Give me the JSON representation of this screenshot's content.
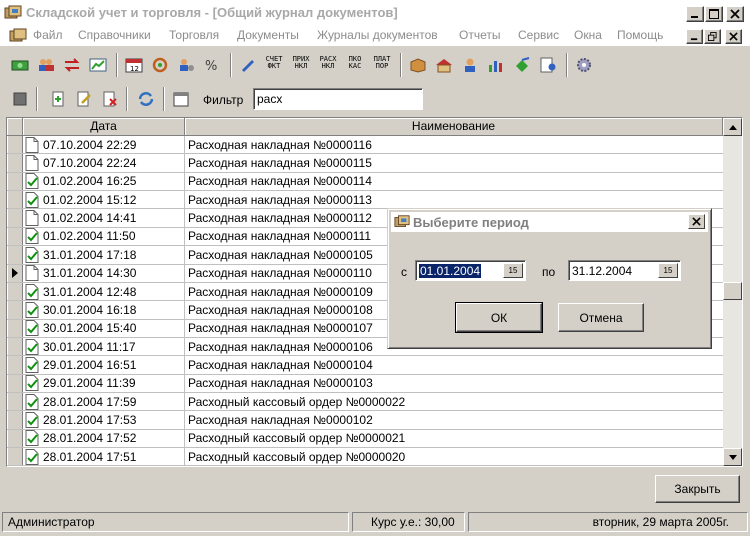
{
  "window": {
    "title": "Складской учет и торговля - [Общий журнал документов]"
  },
  "menu": {
    "items": [
      "Файл",
      "Справочники",
      "Торговля",
      "Документы",
      "Журналы документов",
      "Отчеты",
      "Сервис",
      "Окна",
      "Помощь"
    ]
  },
  "toolbar": {
    "text_buttons": [
      {
        "l1": "СЧЕТ",
        "l2": "ФКТ"
      },
      {
        "l1": "ПРИХ",
        "l2": "НКЛ"
      },
      {
        "l1": "РАСХ",
        "l2": "НКЛ"
      },
      {
        "l1": "ПКО",
        "l2": "КАС"
      },
      {
        "l1": "ПЛАТ",
        "l2": "ПОР"
      }
    ]
  },
  "filter": {
    "label": "Фильтр",
    "value": "расх"
  },
  "grid": {
    "columns": [
      "Дата",
      "Наименование"
    ],
    "rows": [
      {
        "date": "07.10.2004 22:29",
        "name": "Расходная накладная №0000116",
        "posted": false,
        "current": false
      },
      {
        "date": "07.10.2004 22:24",
        "name": "Расходная накладная №0000115",
        "posted": false,
        "current": false
      },
      {
        "date": "01.02.2004 16:25",
        "name": "Расходная накладная №0000114",
        "posted": true,
        "current": false
      },
      {
        "date": "01.02.2004 15:12",
        "name": "Расходная накладная №0000113",
        "posted": true,
        "current": false
      },
      {
        "date": "01.02.2004 14:41",
        "name": "Расходная накладная №0000112",
        "posted": false,
        "current": false
      },
      {
        "date": "01.02.2004 11:50",
        "name": "Расходная накладная №0000111",
        "posted": true,
        "current": false
      },
      {
        "date": "31.01.2004 17:18",
        "name": "Расходная накладная №0000105",
        "posted": true,
        "current": false
      },
      {
        "date": "31.01.2004 14:30",
        "name": "Расходная накладная №0000110",
        "posted": false,
        "current": true
      },
      {
        "date": "31.01.2004 12:48",
        "name": "Расходная накладная №0000109",
        "posted": true,
        "current": false
      },
      {
        "date": "30.01.2004 16:18",
        "name": "Расходная накладная №0000108",
        "posted": true,
        "current": false
      },
      {
        "date": "30.01.2004 15:40",
        "name": "Расходная накладная №0000107",
        "posted": true,
        "current": false
      },
      {
        "date": "30.01.2004 11:17",
        "name": "Расходная накладная №0000106",
        "posted": true,
        "current": false
      },
      {
        "date": "29.01.2004 16:51",
        "name": "Расходная накладная №0000104",
        "posted": true,
        "current": false
      },
      {
        "date": "29.01.2004 11:39",
        "name": "Расходная накладная №0000103",
        "posted": true,
        "current": false
      },
      {
        "date": "28.01.2004 17:59",
        "name": "Расходный кассовый ордер №0000022",
        "posted": true,
        "current": false
      },
      {
        "date": "28.01.2004 17:53",
        "name": "Расходная накладная №0000102",
        "posted": true,
        "current": false
      },
      {
        "date": "28.01.2004 17:52",
        "name": "Расходный кассовый ордер №0000021",
        "posted": true,
        "current": false
      },
      {
        "date": "28.01.2004 17:51",
        "name": "Расходный кассовый ордер №0000020",
        "posted": true,
        "current": false
      }
    ]
  },
  "close_button": "Закрыть",
  "status": {
    "user": "Администратор",
    "rate": "Курс у.е.: 30,00",
    "date": "вторник, 29 марта 2005г."
  },
  "dialog": {
    "title": "Выберите период",
    "from_label": "с",
    "from_value": "01.01.2004",
    "to_label": "по",
    "to_value": "31.12.2004",
    "calendar_button": "15",
    "ok": "ОК",
    "cancel": "Отмена"
  }
}
